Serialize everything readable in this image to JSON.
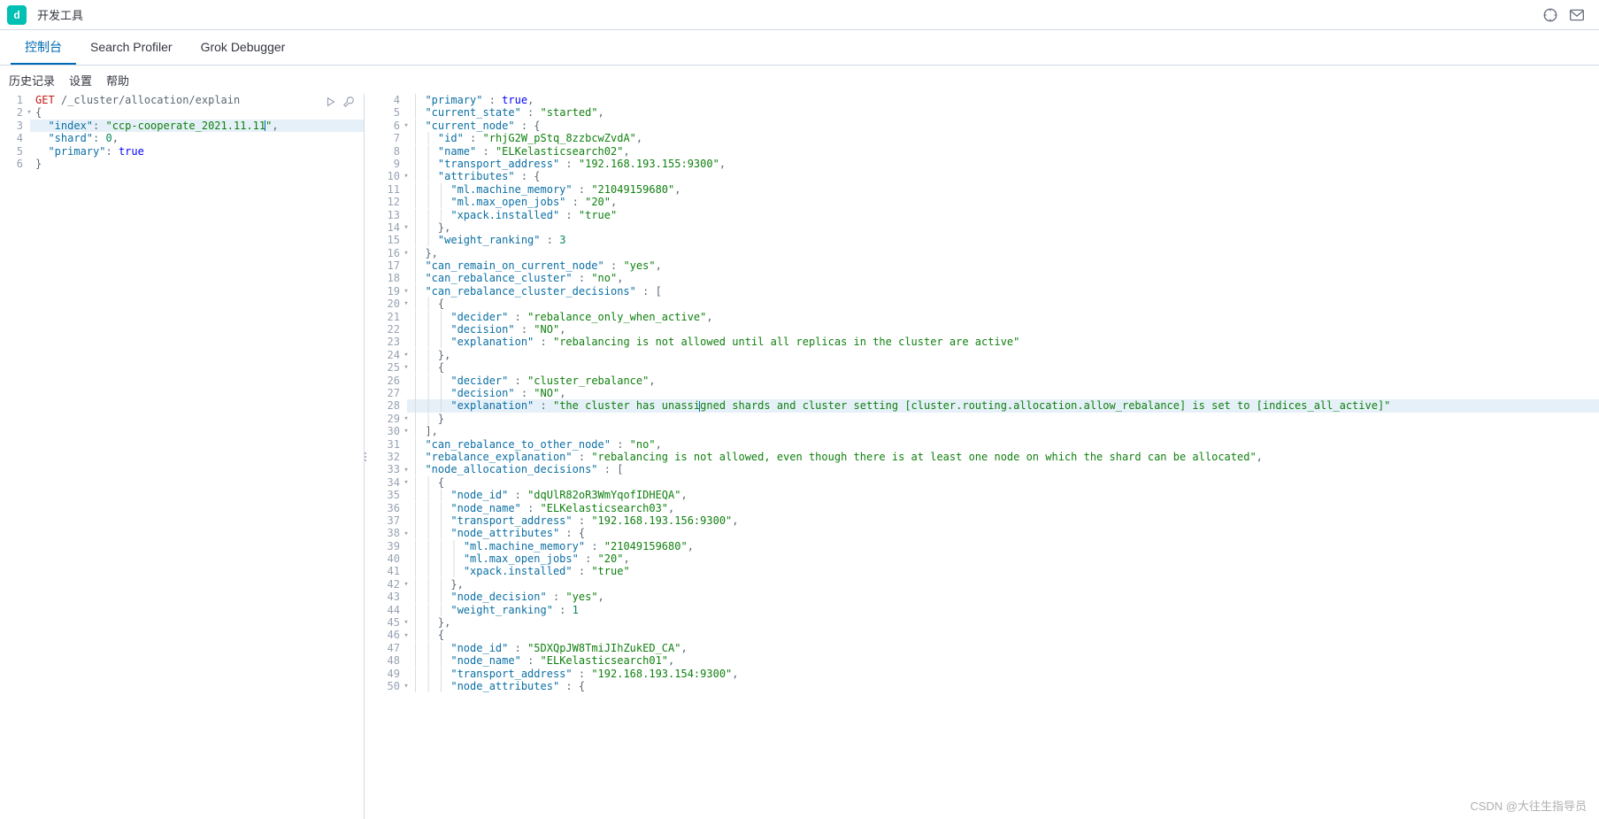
{
  "header": {
    "app_letter": "d",
    "title": "开发工具"
  },
  "tabs": {
    "console": "控制台",
    "profiler": "Search Profiler",
    "grok": "Grok Debugger"
  },
  "menubar": {
    "history": "历史记录",
    "settings": "设置",
    "help": "帮助"
  },
  "request": {
    "lines": [
      {
        "n": 1,
        "method": "GET",
        "path": "/_cluster/allocation/explain"
      },
      {
        "n": 2,
        "fold": true,
        "raw": "{"
      },
      {
        "n": 3,
        "hl": true,
        "key": "index",
        "val": "ccp-cooperate_2021.11.11",
        "trail": ",",
        "cursor": true
      },
      {
        "n": 4,
        "key": "shard",
        "num": "0",
        "trail": ","
      },
      {
        "n": 5,
        "key": "primary",
        "bool": "true"
      },
      {
        "n": 6,
        "raw": "}"
      }
    ]
  },
  "response": {
    "start": 4,
    "lines": [
      {
        "n": 4,
        "ind": 1,
        "k": "primary",
        "post": " : ",
        "bool": "true",
        "t": ","
      },
      {
        "n": 5,
        "ind": 1,
        "k": "current_state",
        "post": " : ",
        "s": "started",
        "t": ","
      },
      {
        "n": 6,
        "fold": true,
        "ind": 1,
        "k": "current_node",
        "post": " : ",
        "raw": "{"
      },
      {
        "n": 7,
        "ind": 2,
        "k": "id",
        "post": " : ",
        "s": "rhjG2W_pStq_8zzbcwZvdA",
        "t": ","
      },
      {
        "n": 8,
        "ind": 2,
        "k": "name",
        "post": " : ",
        "s": "ELKelasticsearch02",
        "t": ","
      },
      {
        "n": 9,
        "ind": 2,
        "k": "transport_address",
        "post": " : ",
        "s": "192.168.193.155:9300",
        "t": ","
      },
      {
        "n": 10,
        "fold": true,
        "ind": 2,
        "k": "attributes",
        "post": " : ",
        "raw": "{"
      },
      {
        "n": 11,
        "ind": 3,
        "k": "ml.machine_memory",
        "post": " : ",
        "s": "21049159680",
        "t": ","
      },
      {
        "n": 12,
        "ind": 3,
        "k": "ml.max_open_jobs",
        "post": " : ",
        "s": "20",
        "t": ","
      },
      {
        "n": 13,
        "ind": 3,
        "k": "xpack.installed",
        "post": " : ",
        "s": "true"
      },
      {
        "n": 14,
        "fold": true,
        "ind": 2,
        "raw": "},"
      },
      {
        "n": 15,
        "ind": 2,
        "k": "weight_ranking",
        "post": " : ",
        "num": "3"
      },
      {
        "n": 16,
        "fold": true,
        "ind": 1,
        "raw": "},"
      },
      {
        "n": 17,
        "ind": 1,
        "k": "can_remain_on_current_node",
        "post": " : ",
        "s": "yes",
        "t": ","
      },
      {
        "n": 18,
        "ind": 1,
        "k": "can_rebalance_cluster",
        "post": " : ",
        "s": "no",
        "t": ","
      },
      {
        "n": 19,
        "fold": true,
        "ind": 1,
        "k": "can_rebalance_cluster_decisions",
        "post": " : ",
        "raw": "["
      },
      {
        "n": 20,
        "fold": true,
        "ind": 2,
        "raw": "{"
      },
      {
        "n": 21,
        "ind": 3,
        "k": "decider",
        "post": " : ",
        "s": "rebalance_only_when_active",
        "t": ","
      },
      {
        "n": 22,
        "ind": 3,
        "k": "decision",
        "post": " : ",
        "s": "NO",
        "t": ","
      },
      {
        "n": 23,
        "ind": 3,
        "k": "explanation",
        "post": " : ",
        "s": "rebalancing is not allowed until all replicas in the cluster are active"
      },
      {
        "n": 24,
        "fold": true,
        "ind": 2,
        "raw": "},"
      },
      {
        "n": 25,
        "fold": true,
        "ind": 2,
        "raw": "{"
      },
      {
        "n": 26,
        "ind": 3,
        "k": "decider",
        "post": " : ",
        "s": "cluster_rebalance",
        "t": ","
      },
      {
        "n": 27,
        "ind": 3,
        "k": "decision",
        "post": " : ",
        "s": "NO",
        "t": ","
      },
      {
        "n": 28,
        "hl": true,
        "ind": 3,
        "k": "explanation",
        "post": " : ",
        "s": "the cluster has unassigned shards and cluster setting [cluster.routing.allocation.allow_rebalance] is set to [indices_all_active]",
        "caret": 22
      },
      {
        "n": 29,
        "fold": true,
        "ind": 2,
        "raw": "}"
      },
      {
        "n": 30,
        "fold": true,
        "ind": 1,
        "raw": "],"
      },
      {
        "n": 31,
        "ind": 1,
        "k": "can_rebalance_to_other_node",
        "post": " : ",
        "s": "no",
        "t": ","
      },
      {
        "n": 32,
        "ind": 1,
        "k": "rebalance_explanation",
        "post": " : ",
        "s": "rebalancing is not allowed, even though there is at least one node on which the shard can be allocated",
        "t": ","
      },
      {
        "n": 33,
        "fold": true,
        "ind": 1,
        "k": "node_allocation_decisions",
        "post": " : ",
        "raw": "["
      },
      {
        "n": 34,
        "fold": true,
        "ind": 2,
        "raw": "{"
      },
      {
        "n": 35,
        "ind": 3,
        "k": "node_id",
        "post": " : ",
        "s": "dqUlR82oR3WmYqofIDHEQA",
        "t": ","
      },
      {
        "n": 36,
        "ind": 3,
        "k": "node_name",
        "post": " : ",
        "s": "ELKelasticsearch03",
        "t": ","
      },
      {
        "n": 37,
        "ind": 3,
        "k": "transport_address",
        "post": " : ",
        "s": "192.168.193.156:9300",
        "t": ","
      },
      {
        "n": 38,
        "fold": true,
        "ind": 3,
        "k": "node_attributes",
        "post": " : ",
        "raw": "{"
      },
      {
        "n": 39,
        "ind": 4,
        "k": "ml.machine_memory",
        "post": " : ",
        "s": "21049159680",
        "t": ","
      },
      {
        "n": 40,
        "ind": 4,
        "k": "ml.max_open_jobs",
        "post": " : ",
        "s": "20",
        "t": ","
      },
      {
        "n": 41,
        "ind": 4,
        "k": "xpack.installed",
        "post": " : ",
        "s": "true"
      },
      {
        "n": 42,
        "fold": true,
        "ind": 3,
        "raw": "},"
      },
      {
        "n": 43,
        "ind": 3,
        "k": "node_decision",
        "post": " : ",
        "s": "yes",
        "t": ","
      },
      {
        "n": 44,
        "ind": 3,
        "k": "weight_ranking",
        "post": " : ",
        "num": "1"
      },
      {
        "n": 45,
        "fold": true,
        "ind": 2,
        "raw": "},"
      },
      {
        "n": 46,
        "fold": true,
        "ind": 2,
        "raw": "{"
      },
      {
        "n": 47,
        "ind": 3,
        "k": "node_id",
        "post": " : ",
        "s": "5DXQpJW8TmiJIhZukED_CA",
        "t": ","
      },
      {
        "n": 48,
        "ind": 3,
        "k": "node_name",
        "post": " : ",
        "s": "ELKelasticsearch01",
        "t": ","
      },
      {
        "n": 49,
        "ind": 3,
        "k": "transport_address",
        "post": " : ",
        "s": "192.168.193.154:9300",
        "t": ","
      },
      {
        "n": 50,
        "fold": true,
        "ind": 3,
        "k": "node_attributes",
        "post": " : ",
        "raw": "{"
      }
    ]
  },
  "watermark": "CSDN @大往生指导员"
}
